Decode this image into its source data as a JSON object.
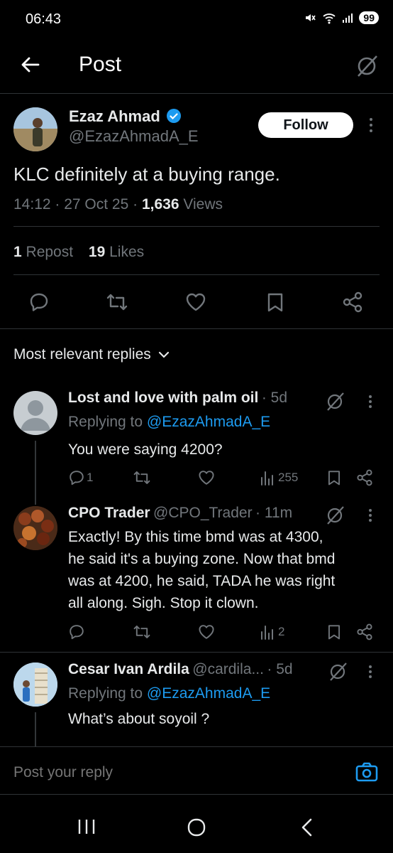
{
  "status_bar": {
    "time": "06:43",
    "battery": "99"
  },
  "header": {
    "title": "Post"
  },
  "post": {
    "author_name": "Ezaz Ahmad",
    "author_handle": "@EzazAhmadA_E",
    "follow_label": "Follow",
    "text": "KLC definitely at a buying range.",
    "time": "14:12",
    "date": "27 Oct 25",
    "views_count": "1,636",
    "views_label": "Views",
    "reposts_count": "1",
    "reposts_label": "Repost",
    "likes_count": "19",
    "likes_label": "Likes"
  },
  "replies_filter": {
    "label": "Most relevant replies"
  },
  "replies": [
    {
      "name": "Lost and love with palm oil",
      "handle": "",
      "time": "· 5d",
      "replying_prefix": "Replying to",
      "replying_to": "@EzazAhmadA_E",
      "text": "You were saying 4200?",
      "reply_count": "1",
      "views": "255"
    },
    {
      "name": "CPO Trader",
      "handle": "@CPO_Trader",
      "time": "· 11m",
      "text_lines": [
        "Exactly! By this time bmd was at 4300,",
        "he said it's a buying zone. Now that bmd",
        "was at 4200, he said, TADA he was right",
        "all along. Sigh. Stop it clown."
      ],
      "views": "2"
    },
    {
      "name": "Cesar Ivan Ardila",
      "handle": "@cardila...",
      "time": "· 5d",
      "replying_prefix": "Replying to",
      "replying_to": "@EzazAhmadA_E",
      "text": "What’s about soyoil ?"
    }
  ],
  "compose": {
    "placeholder": "Post your reply"
  },
  "colors": {
    "background": "#000000",
    "accent": "#1d9bf0",
    "text": "#e7e9ea",
    "muted": "#71767b",
    "divider": "#2f3336"
  }
}
